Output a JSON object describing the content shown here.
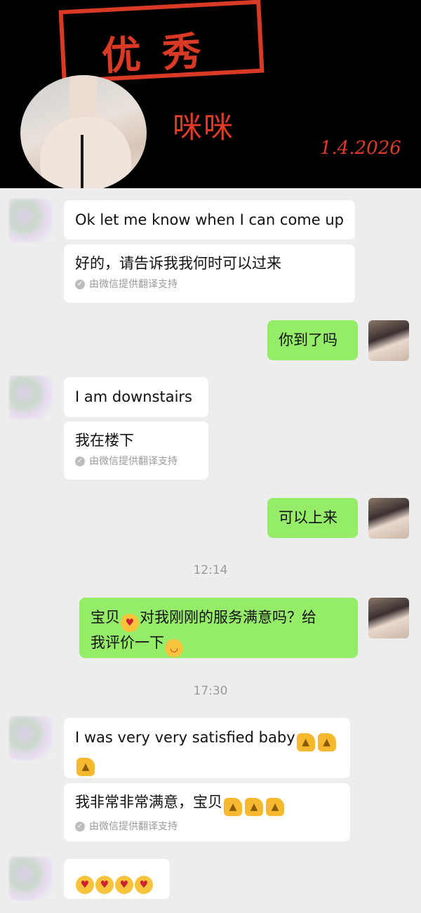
{
  "header": {
    "stamp": "优秀",
    "nickname": "咪咪",
    "date": "1.4.2026"
  },
  "messages": {
    "m1_text": "Ok let me know when I can come up",
    "m1_translation": "好的，请告诉我我何时可以过来",
    "translation_note": "由微信提供翻译支持",
    "m2_text": "你到了吗",
    "m3_text": "I am downstairs",
    "m3_translation": "我在楼下",
    "m4_text": "可以上来",
    "time1": "12:14",
    "m5_text_a": "宝贝",
    "m5_text_b": "对我刚刚的服务满意吗？给",
    "m5_text_c": "我评价一下",
    "time2": "17:30",
    "m6_text": "I was very very satisfied baby",
    "m6_translation": "我非常非常满意，宝贝"
  },
  "icons": {
    "check": "check-circle-icon",
    "thumbs_up": "thumbs-up-emoji",
    "heart_eyes": "heart-eyes-emoji",
    "smile": "smiling-emoji",
    "love_face": "smiling-face-with-hearts-emoji"
  },
  "colors": {
    "accent_red": "#e23b25",
    "bubble_green": "#95ec69",
    "bubble_white": "#ffffff",
    "chat_bg": "#ededed"
  }
}
